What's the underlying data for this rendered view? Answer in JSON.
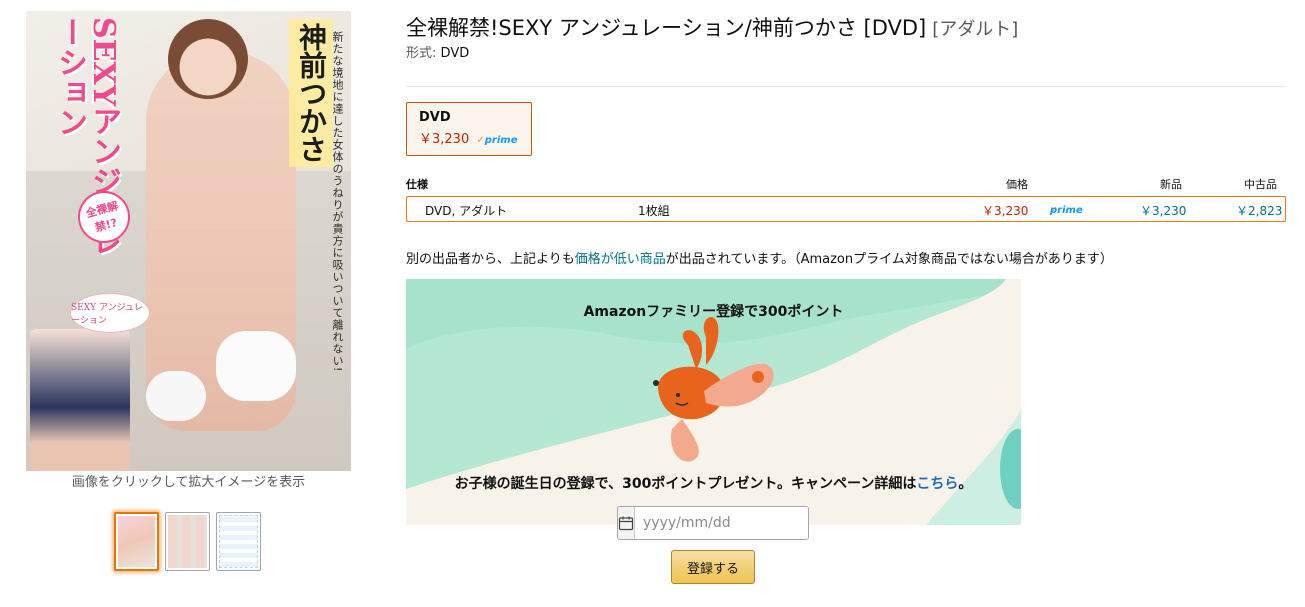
{
  "product": {
    "title": "全裸解禁!SEXY アンジュレーション/神前つかさ [DVD]",
    "category_tag": "[アダルト]",
    "format_label": "形式:",
    "format_value": "DVD"
  },
  "cover": {
    "vertical_title": "SEXYアンジュレーション",
    "vertical_name": "神前つかさ",
    "vertical_sub": "新たな境地に達した女体のうねりが貴方に吸いついて離れない!",
    "badge": "全裸解禁!?",
    "inset_logo": "SEXY アンジュレーション"
  },
  "image_caption": "画像をクリックして拡大イメージを表示",
  "thumbnails": [
    {
      "name": "thumb-1",
      "active": true
    },
    {
      "name": "thumb-2",
      "active": false
    },
    {
      "name": "thumb-3",
      "active": false
    }
  ],
  "swatch": {
    "name": "DVD",
    "price": "￥3,230",
    "prime_label": "prime"
  },
  "spec_table": {
    "headers": {
      "spec": "仕様",
      "price": "価格",
      "new": "新品",
      "used": "中古品"
    },
    "row": {
      "format": "DVD, アダルト",
      "discs": "1枚組",
      "price": "￥3,230",
      "prime_label": "prime",
      "new_price": "￥3,230",
      "used_price": "￥2,823"
    }
  },
  "notice": {
    "before": "別の出品者から、上記よりも",
    "link": "価格が低い商品",
    "after": "が出品されています。（Amazonプライム対象商品ではない場合があります）"
  },
  "promo": {
    "heading": "Amazonファミリー登録で300ポイント",
    "text": "お子様の誕生日の登録で、300ポイントプレゼント。キャンペーン詳細は",
    "link": "こちら",
    "suffix": "。"
  },
  "date_input": {
    "placeholder": "yyyy/mm/dd",
    "value": ""
  },
  "register_button": "登録する",
  "colors": {
    "price_red": "#b12704",
    "link_teal": "#007185",
    "selected_border": "#e47911",
    "button_yellow": "#f0c14b",
    "promo_green": "#9fe0c4"
  }
}
